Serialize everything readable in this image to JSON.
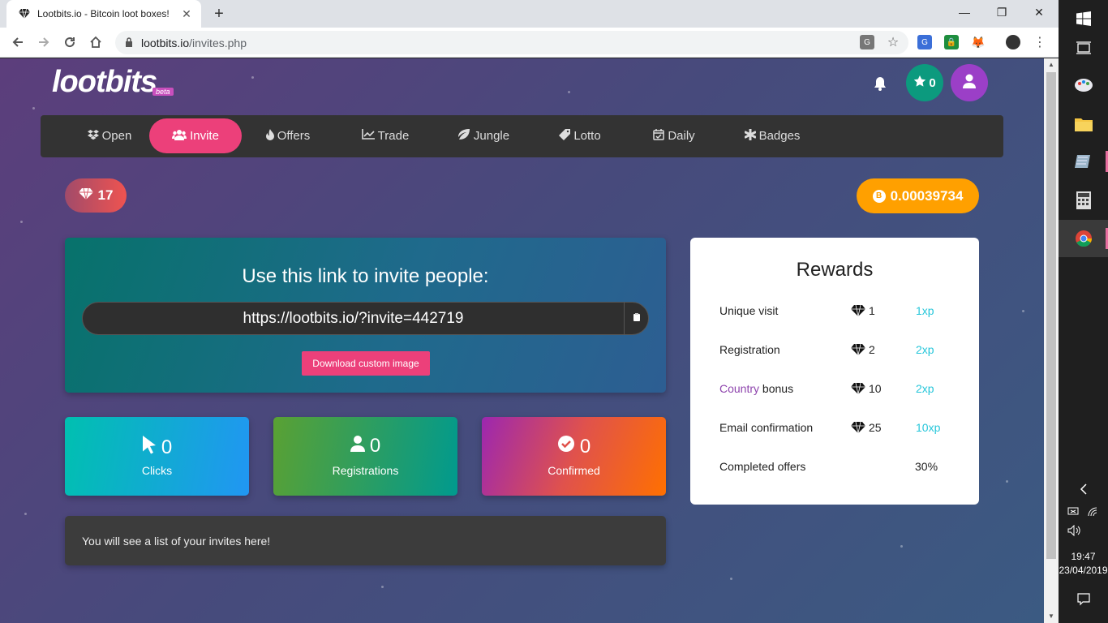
{
  "browser": {
    "tab_title": "Lootbits.io - Bitcoin loot boxes!",
    "new_tab": "+",
    "url_host": "lootbits.io",
    "url_path": "/invites.php",
    "min": "—",
    "max": "❐",
    "close": "✕"
  },
  "site": {
    "logo": "lootbits",
    "beta": "beta",
    "xp": "0"
  },
  "nav": [
    {
      "label": "Open",
      "icon": "dropbox-icon"
    },
    {
      "label": "Invite",
      "icon": "users-icon"
    },
    {
      "label": "Offers",
      "icon": "fire-icon"
    },
    {
      "label": "Trade",
      "icon": "chart-line-icon"
    },
    {
      "label": "Jungle",
      "icon": "leaf-icon"
    },
    {
      "label": "Lotto",
      "icon": "ticket-icon"
    },
    {
      "label": "Daily",
      "icon": "calendar-check-icon"
    },
    {
      "label": "Badges",
      "icon": "asterisk-icon"
    }
  ],
  "balance": {
    "gems": "17",
    "btc": "0.00039734",
    "btc_symbol": "B"
  },
  "invite": {
    "title": "Use this link to invite people:",
    "link": "https://lootbits.io/?invite=442719",
    "download_label": "Download custom image"
  },
  "stats": {
    "clicks": {
      "value": "0",
      "label": "Clicks"
    },
    "registrations": {
      "value": "0",
      "label": "Registrations"
    },
    "confirmed": {
      "value": "0",
      "label": "Confirmed"
    }
  },
  "invites_list_text": "You will see a list of your invites here!",
  "rewards": {
    "title": "Rewards",
    "rows": [
      {
        "label": "Unique visit",
        "gems": "1",
        "xp": "1xp"
      },
      {
        "label": "Registration",
        "gems": "2",
        "xp": "2xp"
      },
      {
        "label_link": "Country",
        "label_rest": " bonus",
        "gems": "10",
        "xp": "2xp"
      },
      {
        "label": "Email confirmation",
        "gems": "25",
        "xp": "10xp"
      },
      {
        "label": "Completed offers",
        "pct": "30%"
      }
    ]
  },
  "taskbar": {
    "time": "19:47",
    "date": "23/04/2019"
  },
  "colors": {
    "accent_pink": "#ec407a",
    "btc_orange": "#ffa000",
    "xp_green": "#0c9a7e",
    "avatar_purple": "#9b3fc7",
    "xp_text": "#26c6da"
  }
}
